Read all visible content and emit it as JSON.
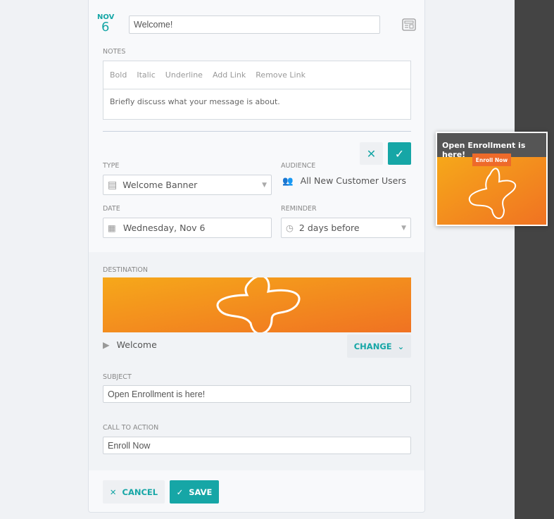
{
  "header": {
    "month": "NOV",
    "day": "6",
    "title": "Welcome!"
  },
  "notes": {
    "label": "NOTES",
    "toolbar": [
      "Bold",
      "Italic",
      "Underline",
      "Add Link",
      "Remove Link"
    ],
    "placeholder": "Briefly discuss what your message is about."
  },
  "type": {
    "label": "TYPE",
    "value": "Welcome Banner"
  },
  "audience": {
    "label": "AUDIENCE",
    "value": "All New Customer Users"
  },
  "date": {
    "label": "DATE",
    "value": "Wednesday, Nov 6"
  },
  "reminder": {
    "label": "REMINDER",
    "value": "2 days before"
  },
  "destination": {
    "label": "DESTINATION",
    "name": "Welcome",
    "change": "CHANGE"
  },
  "subject": {
    "label": "SUBJECT",
    "value": "Open Enrollment is here!"
  },
  "cta": {
    "label": "CALL TO ACTION",
    "value": "Enroll Now"
  },
  "footer": {
    "cancel": "CANCEL",
    "save": "SAVE"
  },
  "preview": {
    "title": "Open Enrollment is here!",
    "button": "Enroll Now"
  },
  "colors": {
    "accent": "#16a6a6",
    "orange": "#f07a22",
    "dark": "#444444"
  }
}
